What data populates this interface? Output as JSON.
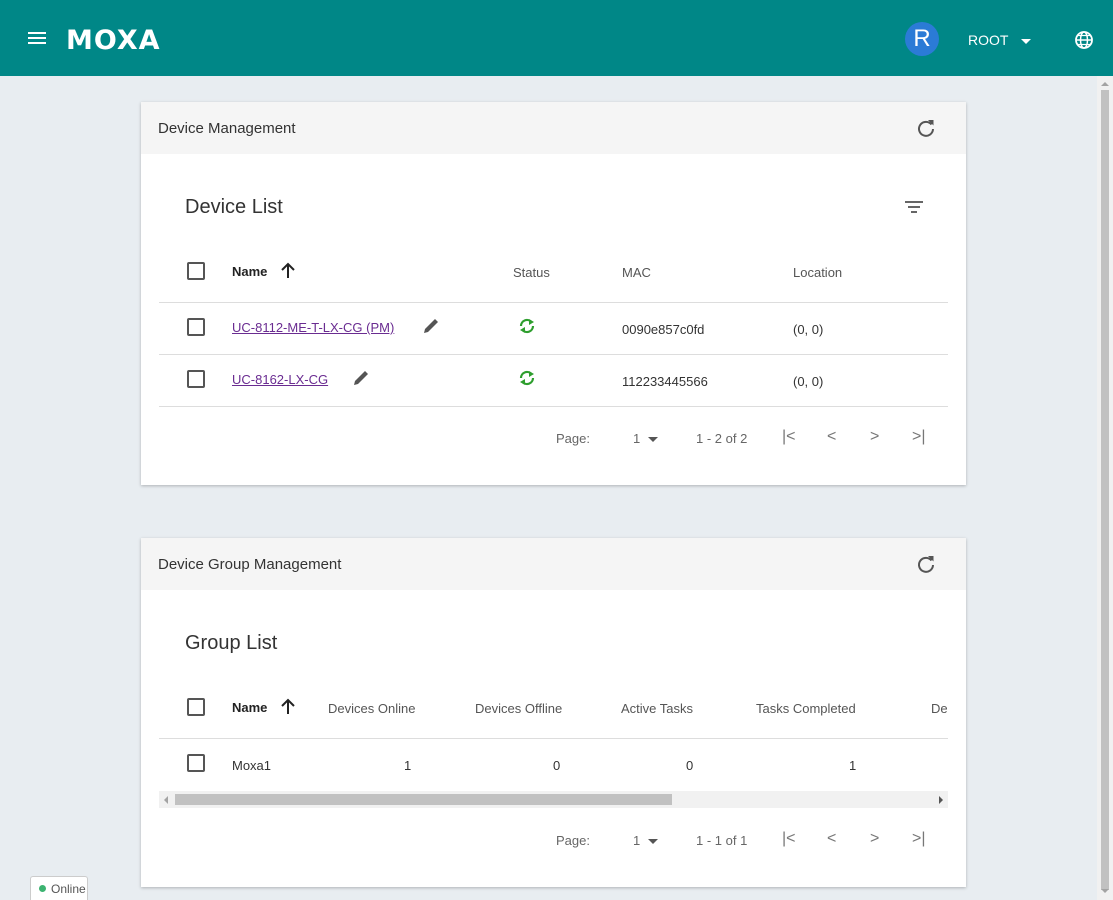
{
  "header": {
    "brand": "MOXA",
    "avatar_letter": "R",
    "user": "ROOT"
  },
  "device_card": {
    "header_title": "Device Management",
    "list_title": "Device List",
    "columns": [
      "Name",
      "Status",
      "MAC",
      "Location"
    ],
    "rows": [
      {
        "name": "UC-8112-ME-T-LX-CG (PM)",
        "mac": "0090e857c0fd",
        "location": "(0, 0)"
      },
      {
        "name": "UC-8162-LX-CG",
        "mac": "112233445566",
        "location": "(0, 0)"
      }
    ],
    "pager": {
      "page_label": "Page:",
      "page": "1",
      "range": "1 - 2 of 2"
    }
  },
  "group_card": {
    "header_title": "Device Group Management",
    "list_title": "Group List",
    "columns": [
      "Name",
      "Devices Online",
      "Devices Offline",
      "Active Tasks",
      "Tasks Completed",
      "Desc"
    ],
    "rows": [
      {
        "name": "Moxa1",
        "online": "1",
        "offline": "0",
        "active": "0",
        "completed": "1"
      }
    ],
    "pager": {
      "page_label": "Page:",
      "page": "1",
      "range": "1 - 1 of 1"
    }
  },
  "status_badge": "Online",
  "colors": {
    "topbar": "#008787",
    "avatar": "#2b7bd6",
    "sync": "#2e9e2e",
    "link": "#6a2c91",
    "online": "#3cb371"
  }
}
